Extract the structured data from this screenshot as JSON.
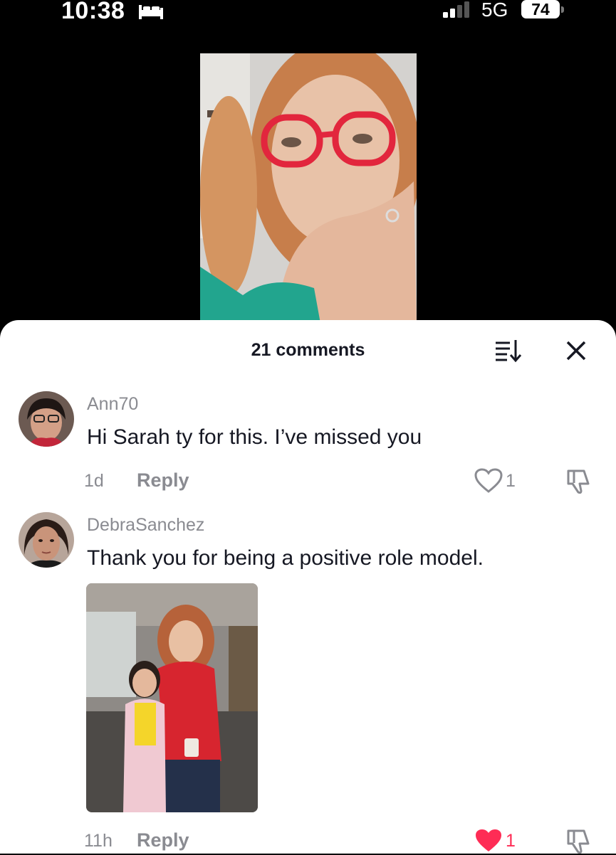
{
  "status_bar": {
    "time": "10:38",
    "network": "5G",
    "battery": "74",
    "icons": [
      "bed-icon",
      "signal-icon"
    ]
  },
  "video": {
    "icon": "video-frame"
  },
  "comments_sheet": {
    "title": "21 comments",
    "icons": [
      "sort-icon",
      "close-icon"
    ],
    "comments": [
      {
        "username": "Ann70",
        "text": "Hi Sarah ty for this. I’ve missed you",
        "time": "1d",
        "reply_label": "Reply",
        "likes": "1",
        "liked": false
      },
      {
        "username": "DebraSanchez",
        "text": "Thank you for being a positive role model.",
        "time": "11h",
        "reply_label": "Reply",
        "likes": "1",
        "liked": true
      }
    ]
  },
  "colors": {
    "like_active": "#fe2c55",
    "muted_text": "#8a8b91",
    "primary_text": "#161823"
  }
}
